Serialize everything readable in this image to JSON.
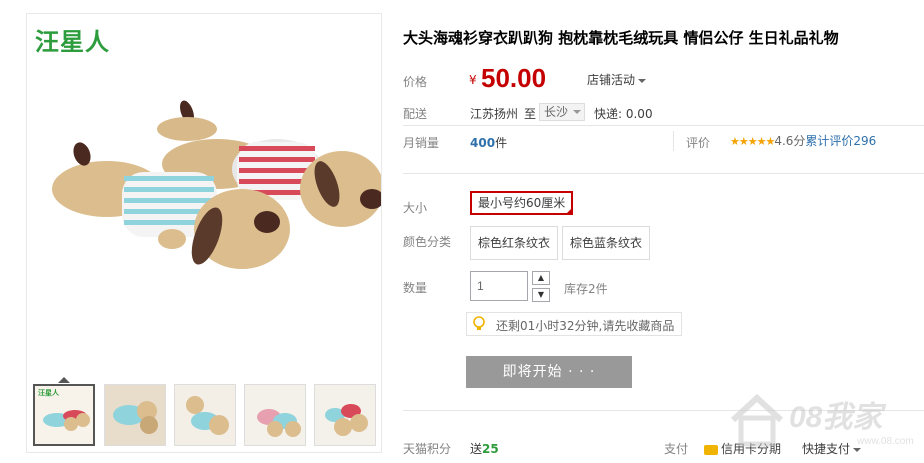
{
  "brand": {
    "logo_text": "汪星人"
  },
  "product": {
    "title": "大头海魂衫穿衣趴趴狗 抱枕靠枕毛绒玩具 情侣公仔 生日礼品礼物"
  },
  "price": {
    "label": "价格",
    "currency": "¥",
    "amount": "50.00",
    "promo": "店铺活动"
  },
  "shipping": {
    "label": "配送",
    "origin": "江苏扬州",
    "to": "至",
    "destination": "长沙",
    "fee": "快递: 0.00"
  },
  "sales": {
    "label": "月销量",
    "count": "400",
    "unit": "件",
    "rating_label": "评价",
    "stars": "★★★★★",
    "score": "4.6分",
    "reviews": "累计评价296"
  },
  "size": {
    "label": "大小",
    "options": [
      "最小号约60厘米"
    ],
    "selected": "最小号约60厘米"
  },
  "color": {
    "label": "颜色分类",
    "options": [
      "棕色红条纹衣",
      "棕色蓝条纹衣"
    ]
  },
  "quantity": {
    "label": "数量",
    "value": "1",
    "stock": "库存2件",
    "up": "▲",
    "down": "▼"
  },
  "tip": {
    "text": "还剩01小时32分钟,请先收藏商品"
  },
  "buy_button": {
    "label": "即将开始 · · ·"
  },
  "footer": {
    "points_label": "天猫积分",
    "points_prefix": "送",
    "points_value": "25",
    "pay_label": "支付",
    "pay_card": "信用卡分期",
    "pay_quick": "快捷支付"
  },
  "watermark": {
    "text": "08我家",
    "url": "www.08.com"
  },
  "colors": {
    "price": "#c40000",
    "link": "#2f70ac",
    "green": "#2d9c3c",
    "buy_disabled": "#999999"
  }
}
